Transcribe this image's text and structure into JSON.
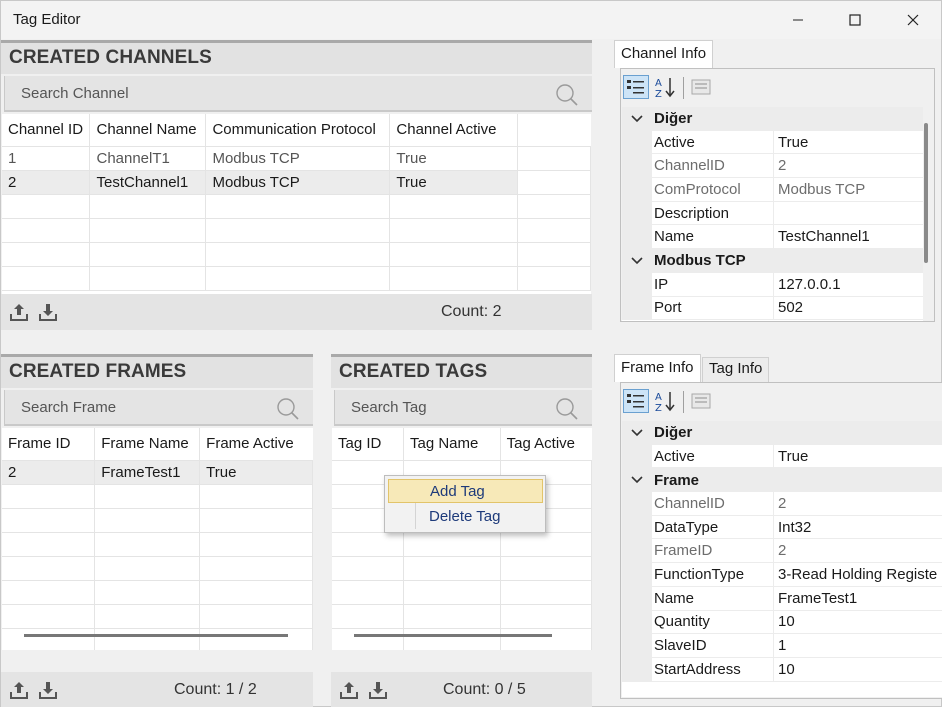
{
  "window": {
    "title": "Tag Editor"
  },
  "channels": {
    "header": "CREATED CHANNELS",
    "search_placeholder": "Search Channel",
    "columns": [
      "Channel ID",
      "Channel Name",
      "Communication Protocol",
      "Channel Active"
    ],
    "rows": [
      [
        "1",
        "ChannelT1",
        "Modbus TCP",
        "True"
      ],
      [
        "2",
        "TestChannel1",
        "Modbus TCP",
        "True"
      ]
    ],
    "count": "Count: 2"
  },
  "frames": {
    "header": "CREATED FRAMES",
    "search_placeholder": "Search Frame",
    "columns": [
      "Frame ID",
      "Frame Name",
      "Frame Active"
    ],
    "rows": [
      [
        "2",
        "FrameTest1",
        "True"
      ]
    ],
    "count": "Count: 1 / 2"
  },
  "tags": {
    "header": "CREATED TAGS",
    "search_placeholder": "Search Tag",
    "columns": [
      "Tag ID",
      "Tag Name",
      "Tag Active"
    ],
    "count": "Count: 0 / 5"
  },
  "context_menu": {
    "items": [
      "Add Tag",
      "Delete Tag"
    ]
  },
  "channel_info": {
    "tab": "Channel Info",
    "categories": [
      {
        "name": "Diğer",
        "props": [
          {
            "k": "Active",
            "v": "True",
            "dim": false
          }
        ]
      },
      {
        "name": "",
        "props": []
      }
    ],
    "rows": [
      {
        "type": "cat",
        "k": "Diğer"
      },
      {
        "type": "prop",
        "k": "Active",
        "v": "True",
        "dim": false
      },
      {
        "type": "prop",
        "k": "ChannelID",
        "v": "2",
        "dim": true
      },
      {
        "type": "prop",
        "k": "ComProtocol",
        "v": "Modbus TCP",
        "dim": true
      },
      {
        "type": "prop",
        "k": "Description",
        "v": "",
        "dim": false
      },
      {
        "type": "prop",
        "k": "Name",
        "v": "TestChannel1",
        "dim": false
      },
      {
        "type": "cat",
        "k": "Modbus TCP"
      },
      {
        "type": "prop",
        "k": "IP",
        "v": "127.0.0.1",
        "dim": false
      },
      {
        "type": "prop",
        "k": "Port",
        "v": "502",
        "dim": false
      }
    ]
  },
  "frame_info": {
    "tabs": [
      "Frame Info",
      "Tag Info"
    ],
    "rows": [
      {
        "type": "cat",
        "k": "Diğer"
      },
      {
        "type": "prop",
        "k": "Active",
        "v": "True",
        "dim": false
      },
      {
        "type": "cat",
        "k": "Frame"
      },
      {
        "type": "prop",
        "k": "ChannelID",
        "v": "2",
        "dim": true
      },
      {
        "type": "prop",
        "k": "DataType",
        "v": "Int32",
        "dim": false
      },
      {
        "type": "prop",
        "k": "FrameID",
        "v": "2",
        "dim": true
      },
      {
        "type": "prop",
        "k": "FunctionType",
        "v": "3-Read Holding Registe",
        "dim": false
      },
      {
        "type": "prop",
        "k": "Name",
        "v": "FrameTest1",
        "dim": false
      },
      {
        "type": "prop",
        "k": "Quantity",
        "v": "10",
        "dim": false
      },
      {
        "type": "prop",
        "k": "SlaveID",
        "v": "1",
        "dim": false
      },
      {
        "type": "prop",
        "k": "StartAddress",
        "v": "10",
        "dim": false
      }
    ]
  }
}
